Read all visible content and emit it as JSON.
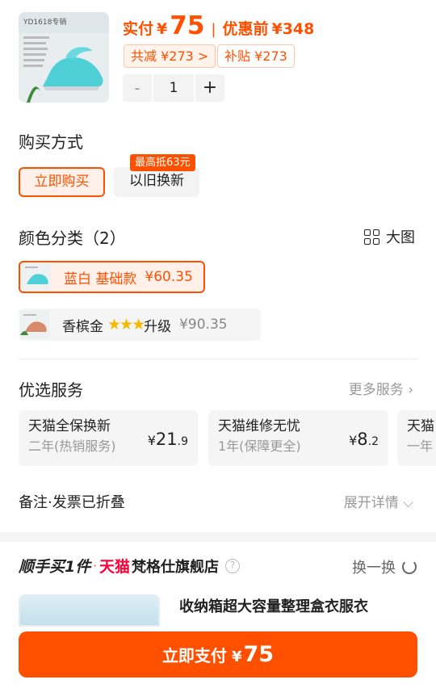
{
  "product": {
    "image_alt": "steam iron product image",
    "actual_label": "实付",
    "currency": "¥",
    "actual_price": "75",
    "separator": "|",
    "original_label": "优惠前",
    "original_price": "¥348",
    "total_discount": "共减 ¥273 >",
    "subsidy": "补贴 ¥273"
  },
  "quantity": {
    "minus": "-",
    "value": "1",
    "plus": "+"
  },
  "purchase_method": {
    "title": "购买方式",
    "options": [
      "立即购买",
      "以旧换新"
    ],
    "badge": "最高抵63元"
  },
  "color": {
    "title": "颜色分类（2）",
    "view_toggle": "大图",
    "items": [
      {
        "name": "蓝白 基础款",
        "price": "¥60.35",
        "selected": true
      },
      {
        "name": "香槟金",
        "stars": "★★★",
        "suffix": "升级",
        "price": "¥90.35",
        "selected": false
      }
    ]
  },
  "services": {
    "title": "优选服务",
    "more": "更多服务 ›",
    "cards": [
      {
        "name": "天猫全保换新",
        "desc": "二年(热销服务)",
        "currency": "¥",
        "int": "21",
        "dec": ".9"
      },
      {
        "name": "天猫维修无忧",
        "desc": "1年(保障更全)",
        "currency": "¥",
        "int": "8",
        "dec": ".2"
      },
      {
        "name": "天猫",
        "desc": "一年"
      }
    ]
  },
  "note": {
    "label": "备注·发票已折叠",
    "expand": "展开详情 ⌵"
  },
  "recommend": {
    "prefix": "顺手买1件",
    "dot": "·",
    "tmall": "天猫",
    "shop": "梵格仕旗舰店",
    "help": "?",
    "refresh": "换一换",
    "product_title": "收纳箱超大容量整理盒衣服衣"
  },
  "pay": {
    "label": "立即支付",
    "currency": "¥",
    "amount": "75"
  },
  "colors": {
    "accent": "#ff5000",
    "tmall_red": "#ff0036",
    "star": "#f5b800"
  }
}
